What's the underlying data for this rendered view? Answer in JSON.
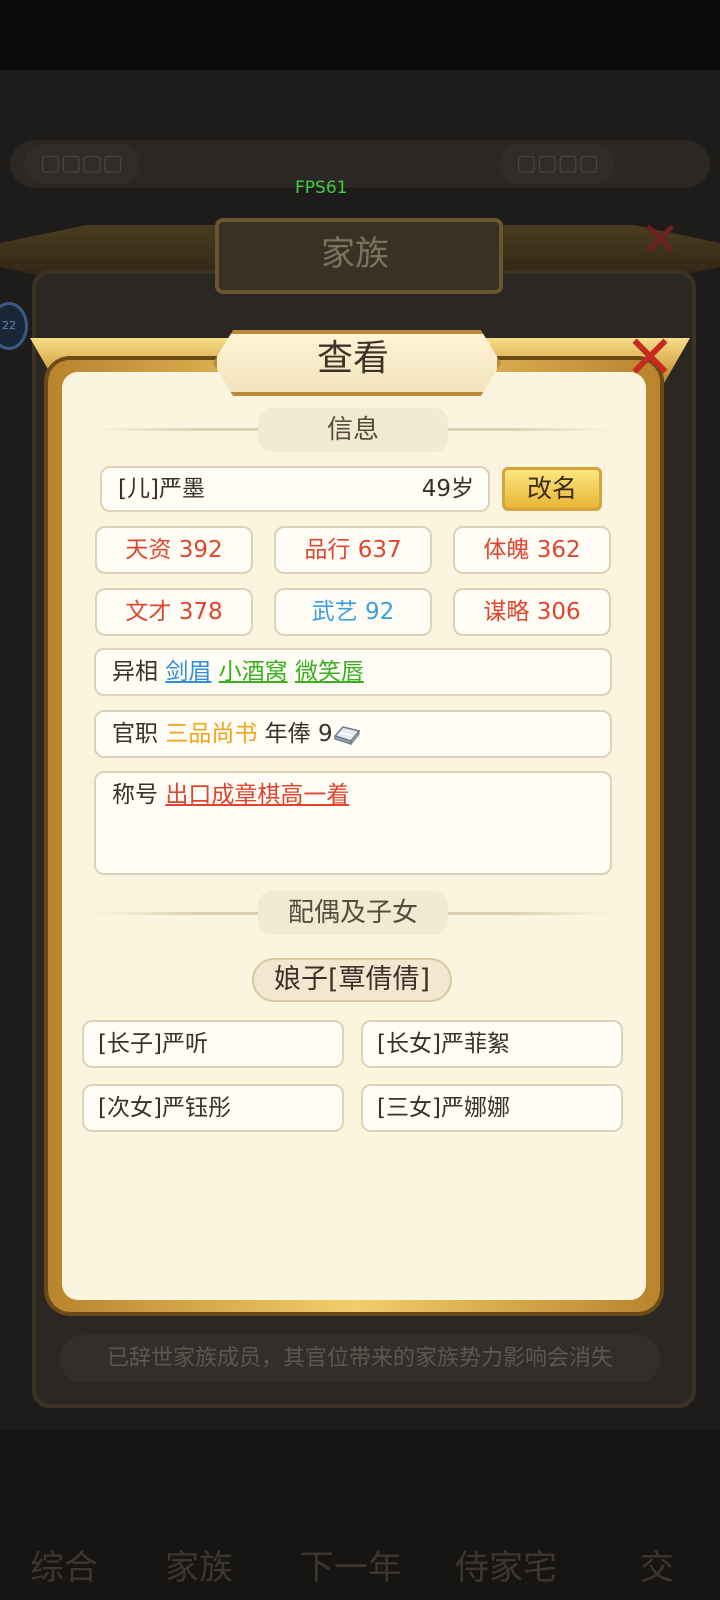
{
  "status": {
    "fps": "FPS61"
  },
  "family_panel": {
    "title": "家族",
    "footer_note": "已辞世家族成员，其官位带来的家族势力影响会消失",
    "side_badge": "22"
  },
  "nav": {
    "items": [
      "综合",
      "家族",
      "下一年",
      "侍家宅",
      "交"
    ]
  },
  "dialog": {
    "title": "查看",
    "info_section_label": "信息",
    "member": {
      "name": "[儿]严墨",
      "age": "49岁",
      "rename_label": "改名"
    },
    "stats": [
      {
        "label": "天资 392",
        "color": "#e0452f"
      },
      {
        "label": "品行 637",
        "color": "#e0452f"
      },
      {
        "label": "体魄 362",
        "color": "#e0452f"
      },
      {
        "label": "文才 378",
        "color": "#e0452f"
      },
      {
        "label": "武艺 92",
        "color": "#3d9fde"
      },
      {
        "label": "谋略 306",
        "color": "#e0452f"
      }
    ],
    "traits": {
      "label": "异相",
      "values": [
        "剑眉",
        "小酒窝",
        "微笑唇"
      ]
    },
    "office": {
      "label": "官职",
      "rank": "三品尚书",
      "salary_label": "年俸",
      "salary_value": "9",
      "salary_icon": "silver-ingot-icon"
    },
    "titles": {
      "label": "称号",
      "values": [
        "出口成章",
        "棋高一着"
      ]
    },
    "family_section_label": "配偶及子女",
    "spouse": "娘子[覃倩倩]",
    "children": [
      "[长子]严听",
      "[长女]严菲絮",
      "[次女]严钰彤",
      "[三女]严娜娜"
    ]
  }
}
